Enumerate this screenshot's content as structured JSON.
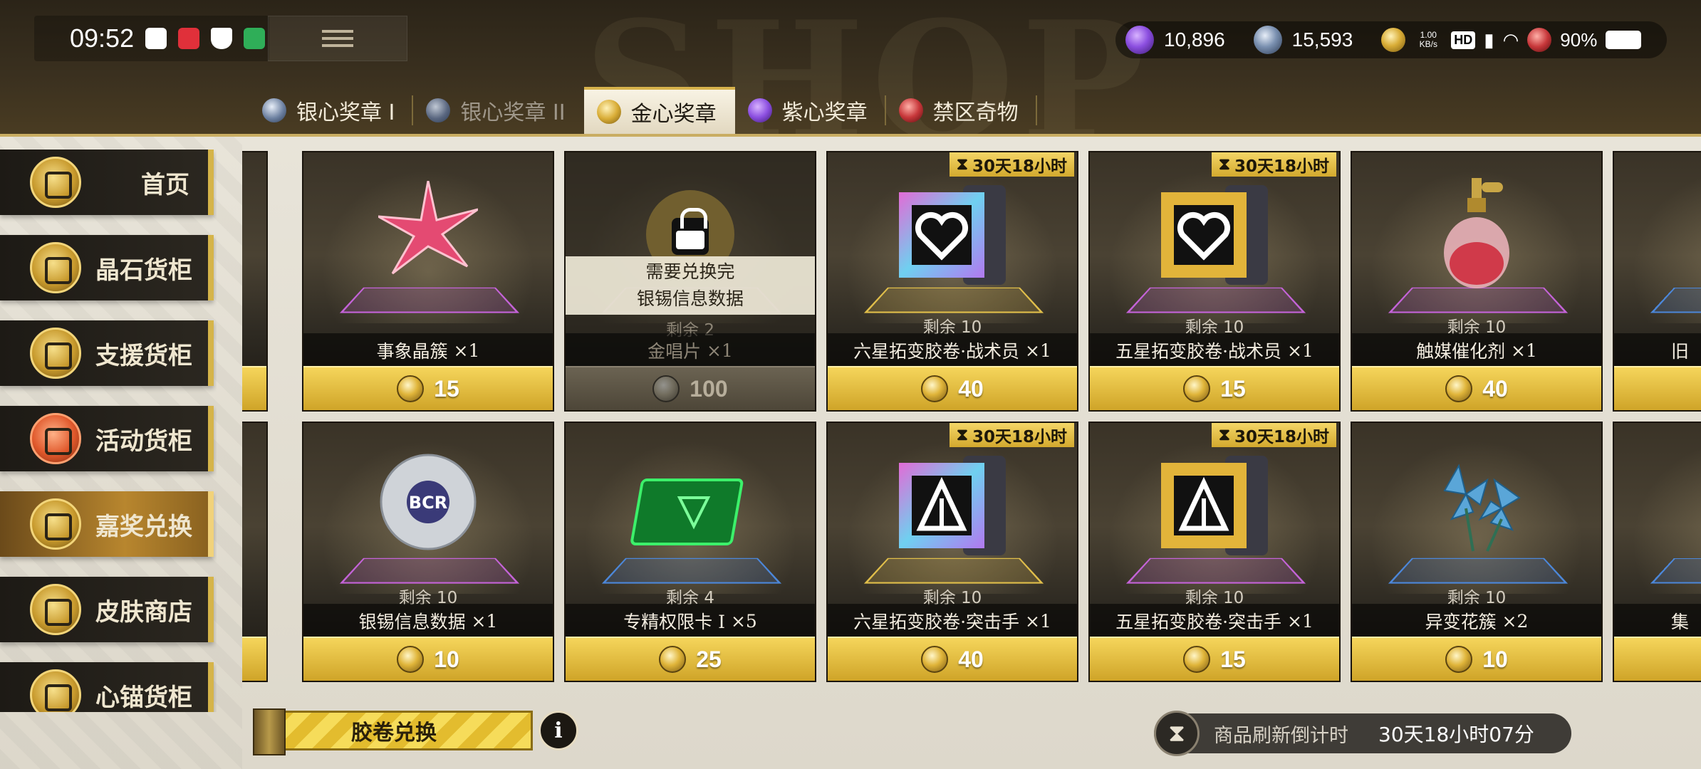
{
  "status": {
    "time": "09:52",
    "network_speed": "1.00 KB/s",
    "battery": "90%"
  },
  "currencies": [
    {
      "icon": "purple-gem-icon",
      "value": "10,896"
    },
    {
      "icon": "silver-gem-icon",
      "value": "15,593"
    }
  ],
  "tabs": [
    {
      "label": "银心奖章 I",
      "icon": "silver-medal-icon",
      "state": "normal"
    },
    {
      "label": "银心奖章 II",
      "icon": "silver-medal-icon",
      "state": "dim"
    },
    {
      "label": "金心奖章",
      "icon": "gold-medal-icon",
      "state": "active"
    },
    {
      "label": "紫心奖章",
      "icon": "purple-medal-icon",
      "state": "normal"
    },
    {
      "label": "禁区奇物",
      "icon": "red-medal-icon",
      "state": "normal"
    }
  ],
  "background_word": "SHOP",
  "sidebar": [
    {
      "label": "首页",
      "icon": "home-icon"
    },
    {
      "label": "晶石货柜",
      "icon": "crystal-icon"
    },
    {
      "label": "支援货柜",
      "icon": "crate-icon"
    },
    {
      "label": "活动货柜",
      "icon": "event-crate-icon"
    },
    {
      "label": "嘉奖兑换",
      "icon": "award-icon",
      "active": true
    },
    {
      "label": "皮肤商店",
      "icon": "outfit-icon"
    },
    {
      "label": "心锚货柜",
      "icon": "anchor-icon"
    }
  ],
  "cards": [
    {
      "name": "事象晶簇",
      "qty": "×1",
      "remain": "",
      "price": "15",
      "floor": "purple",
      "item": "crystal-star"
    },
    {
      "name": "金唱片",
      "qty": "×1",
      "remain": "剩余 2",
      "price": "100",
      "floor": "purple",
      "item": "gold-disc",
      "locked": true,
      "lock_text_1": "需要兑换完",
      "lock_text_2": "银锡信息数据"
    },
    {
      "name": "六星拓变胶卷·战术员",
      "qty": "×1",
      "remain": "剩余 10",
      "price": "40",
      "floor": "gold",
      "item": "film-heart-rainbow",
      "timer": "30天18小时"
    },
    {
      "name": "五星拓变胶卷·战术员",
      "qty": "×1",
      "remain": "剩余 10",
      "price": "15",
      "floor": "purple",
      "item": "film-heart-gold",
      "timer": "30天18小时"
    },
    {
      "name": "触媒催化剂",
      "qty": "×1",
      "remain": "剩余 10",
      "price": "40",
      "floor": "purple",
      "item": "perfume-bottle"
    },
    {
      "name": "旧",
      "qty": "",
      "remain": "",
      "price": "",
      "floor": "blue",
      "item": "partial",
      "partial": true
    },
    {
      "name": "银锡信息数据",
      "qty": "×1",
      "remain": "剩余 10",
      "price": "10",
      "floor": "purple",
      "item": "silver-disc"
    },
    {
      "name": "专精权限卡 I",
      "qty": "×5",
      "remain": "剩余 4",
      "price": "25",
      "floor": "blue",
      "item": "green-card"
    },
    {
      "name": "六星拓变胶卷·突击手",
      "qty": "×1",
      "remain": "剩余 10",
      "price": "40",
      "floor": "gold",
      "item": "film-assault-rainbow",
      "timer": "30天18小时"
    },
    {
      "name": "五星拓变胶卷·突击手",
      "qty": "×1",
      "remain": "剩余 10",
      "price": "15",
      "floor": "purple",
      "item": "film-assault-gold",
      "timer": "30天18小时"
    },
    {
      "name": "异变花簇",
      "qty": "×2",
      "remain": "剩余 10",
      "price": "10",
      "floor": "blue",
      "item": "blue-lily"
    },
    {
      "name": "集",
      "qty": "",
      "remain": "",
      "price": "",
      "floor": "blue",
      "item": "partial",
      "partial": true
    }
  ],
  "bottom": {
    "exchange_label": "胶卷兑换",
    "info_label": "i",
    "refresh_label": "商品刷新倒计时",
    "refresh_value": "30天18小时07分"
  },
  "colors": {
    "gold_accent": "#d5b449",
    "price_bar": "#f5d55b",
    "panel_bg": "#e8e4d9",
    "dark_card": "#2e2a22"
  }
}
